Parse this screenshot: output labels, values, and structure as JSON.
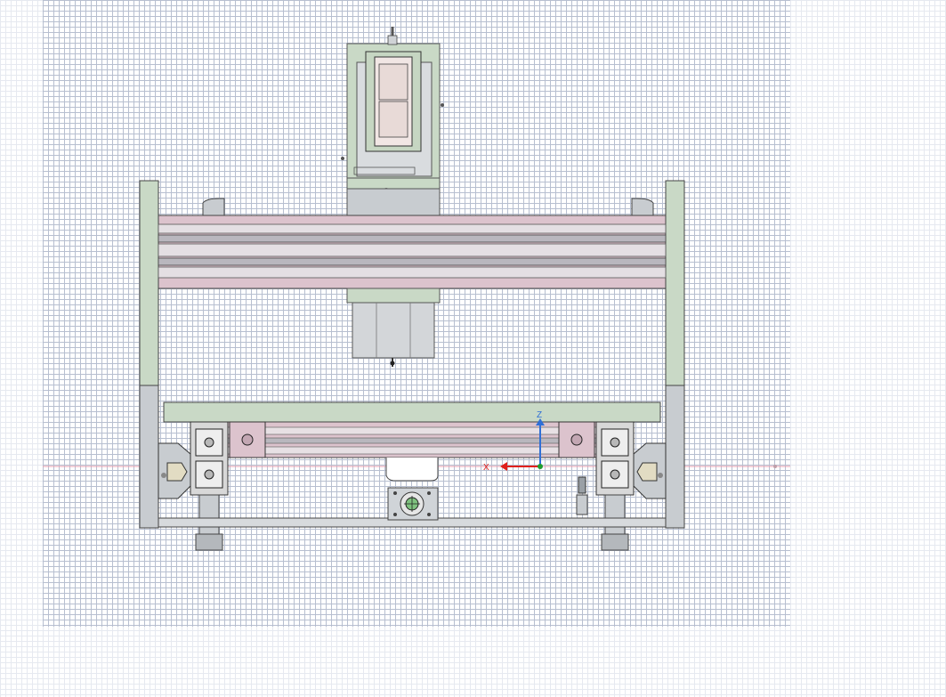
{
  "viewport": {
    "view": "front"
  },
  "triad": {
    "x_label": "X",
    "z_label": "Z",
    "x_color": "#e0201c",
    "z_color": "#2f6fd6",
    "origin_color": "#1f9d2f"
  },
  "colors": {
    "grid_major": "#b7bfd0",
    "grid_minor": "#e6e9f0",
    "frame_green": "#c9d9c6",
    "rail_pink": "#dcc3cd",
    "metal_grey": "#c8ccd0",
    "origin_line": "#e8a0b0"
  }
}
